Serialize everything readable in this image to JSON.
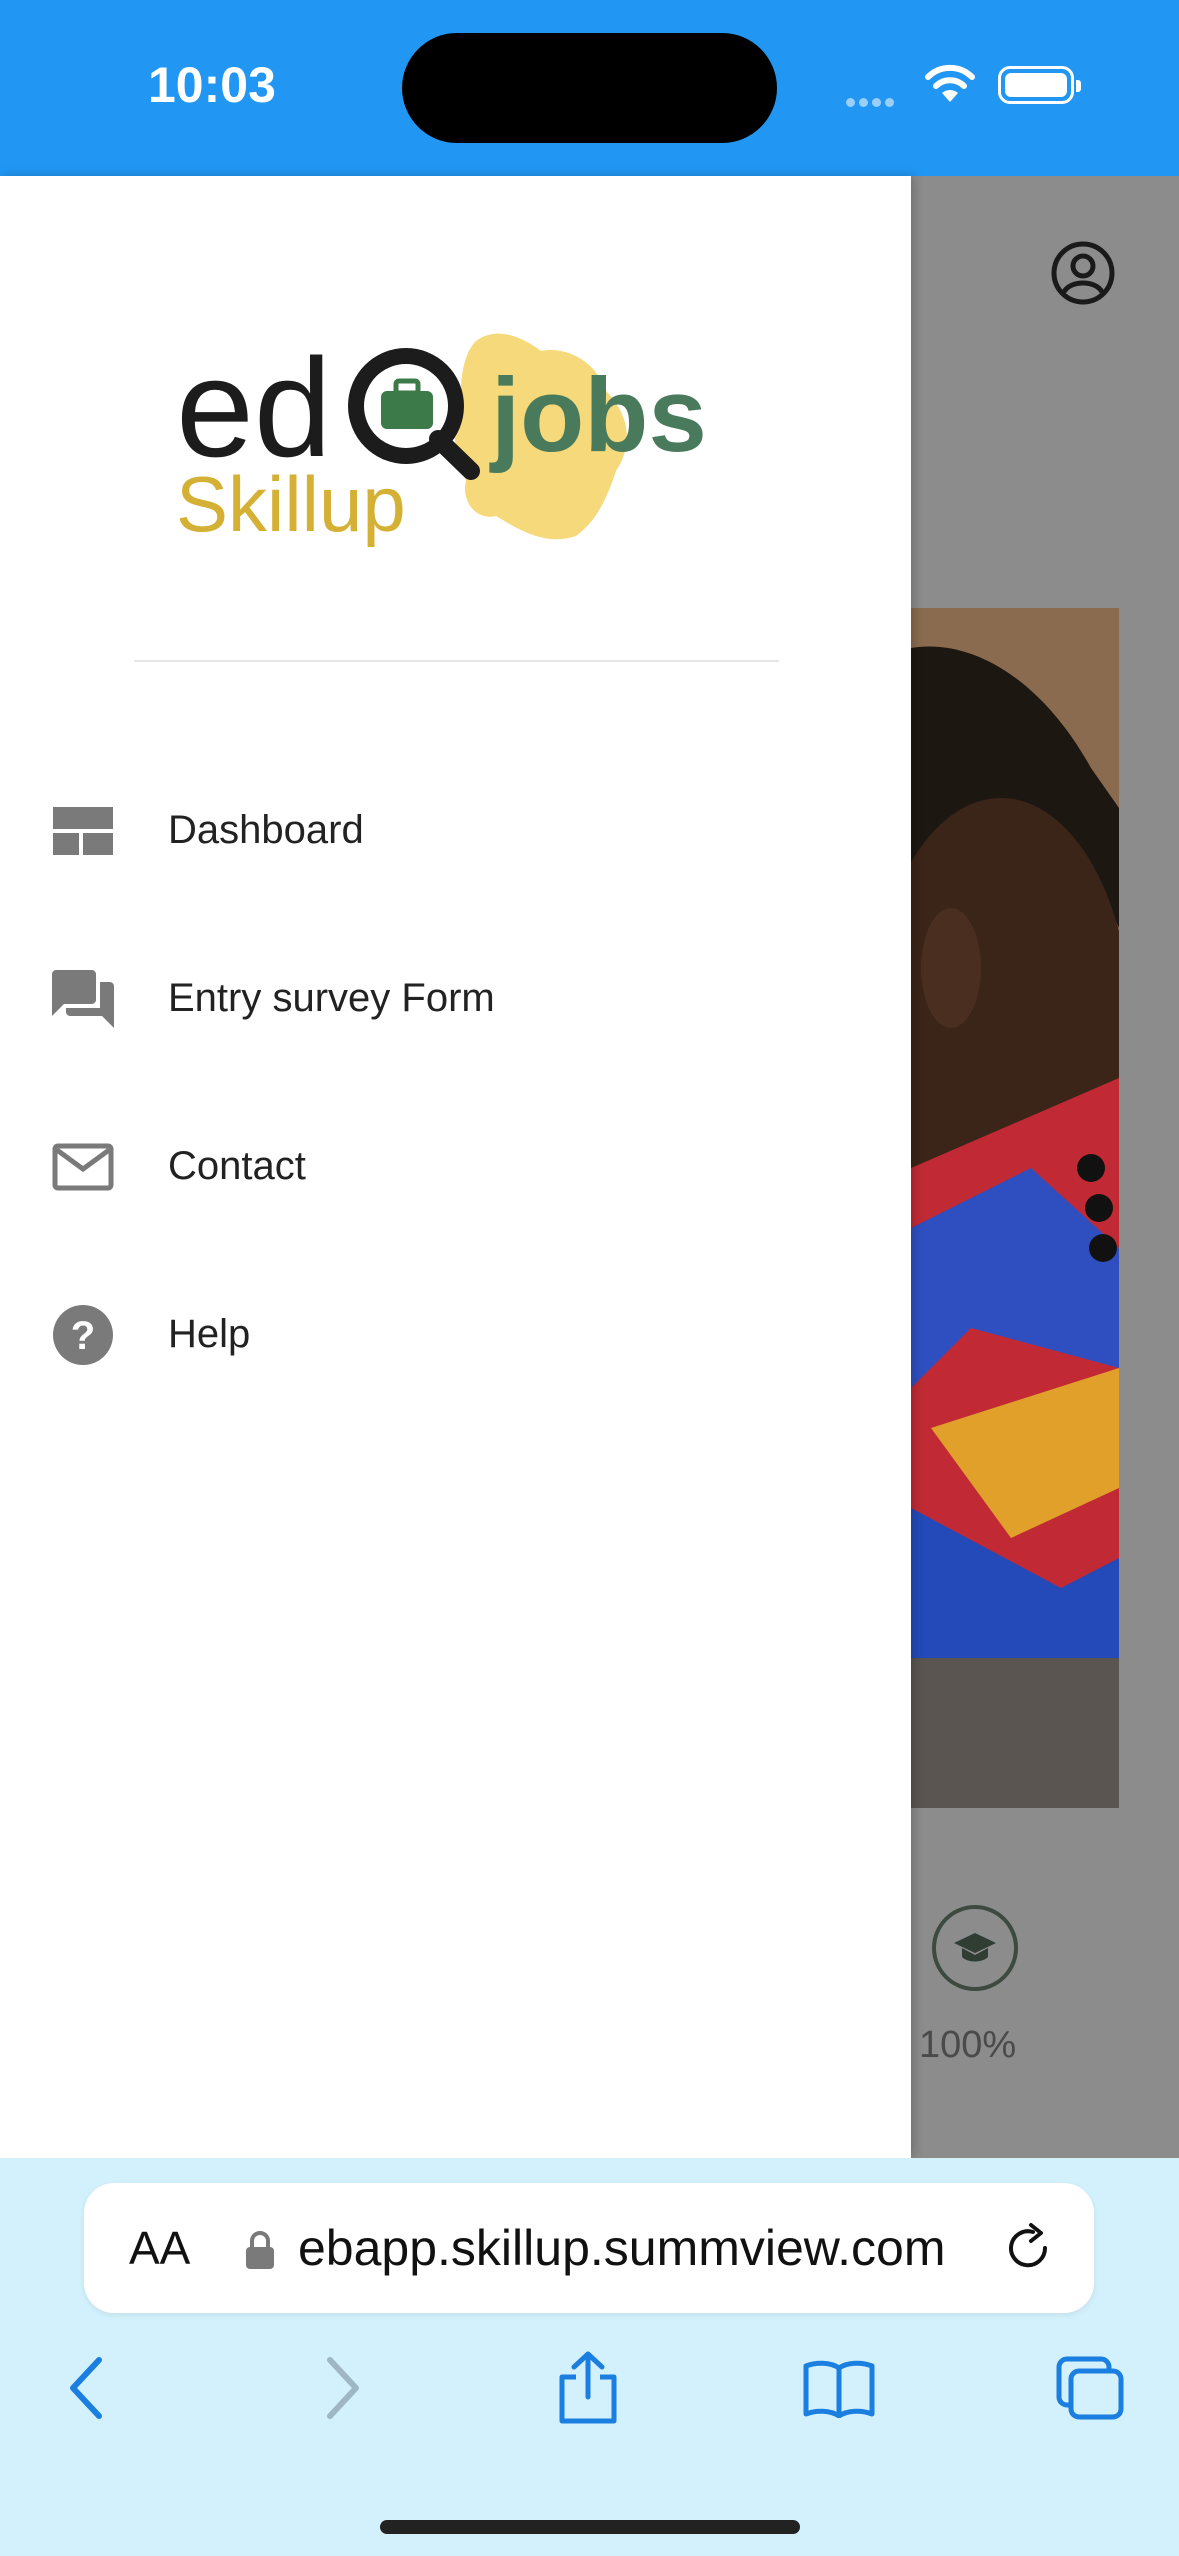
{
  "status_bar": {
    "time": "10:03"
  },
  "background_page": {
    "progress_text": "100%"
  },
  "drawer": {
    "logo_text": {
      "line1": "edo",
      "line1b": "jobs",
      "line2": "Skillup"
    },
    "items": [
      {
        "label": "Dashboard",
        "icon": "dashboard-icon"
      },
      {
        "label": "Entry survey Form",
        "icon": "forum-icon"
      },
      {
        "label": "Contact",
        "icon": "mail-icon"
      },
      {
        "label": "Help",
        "icon": "help-icon"
      }
    ]
  },
  "safari": {
    "aa_label": "AA",
    "url": "ebapp.skillup.summview.com"
  },
  "colors": {
    "status_bar": "#2196f3",
    "drawer_icon": "#7a7a7a",
    "safari_bg": "#d3f1fc",
    "safari_accent": "#1a7fe0"
  }
}
